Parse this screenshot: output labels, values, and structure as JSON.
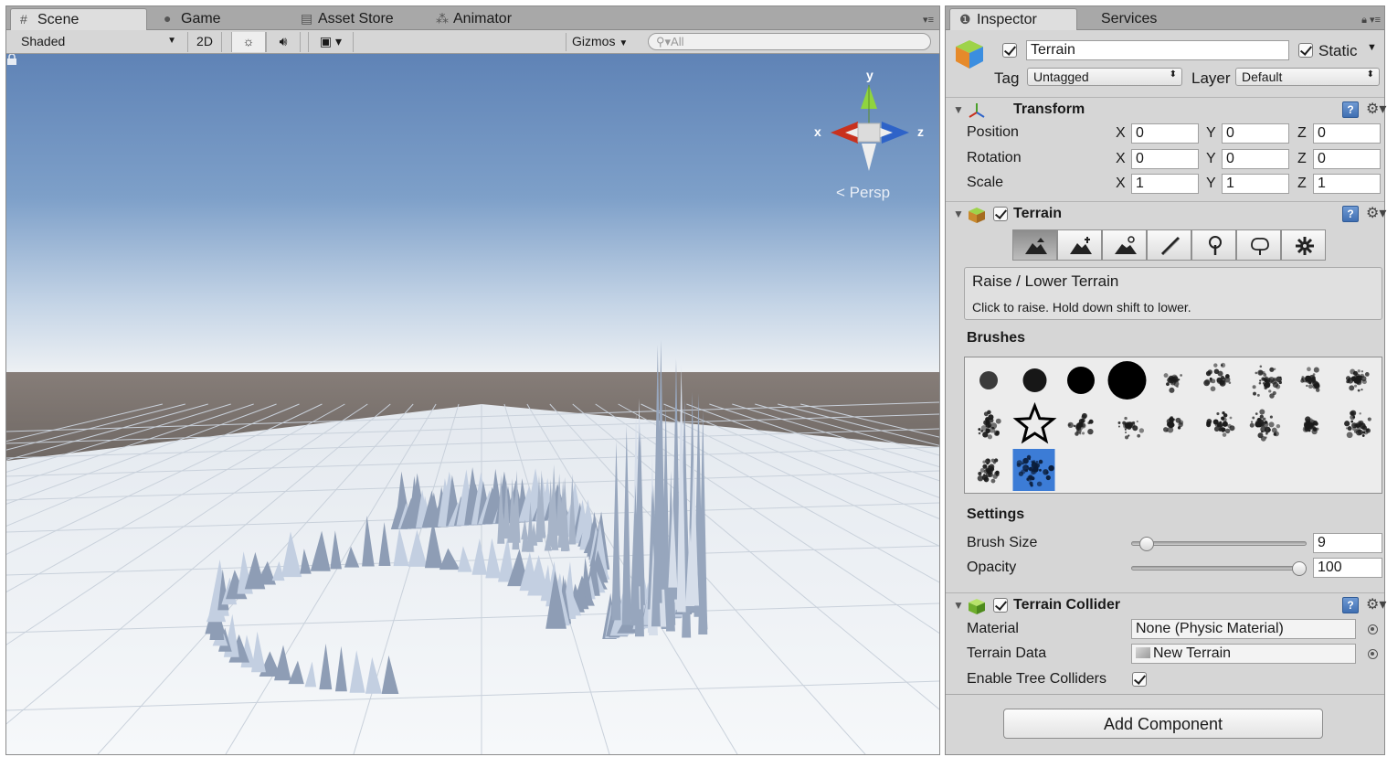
{
  "scene_tabs": [
    {
      "label": "Scene",
      "icon": "hash-grid-icon"
    },
    {
      "label": "Game",
      "icon": "pacman-icon"
    },
    {
      "label": "Asset Store",
      "icon": "store-bag-icon"
    },
    {
      "label": "Animator",
      "icon": "animator-nodes-icon"
    }
  ],
  "scene_toolbar": {
    "draw_mode": "Shaded",
    "mode_2d": "2D",
    "gizmos": "Gizmos",
    "search_placeholder": "All"
  },
  "viewport": {
    "projection": "Persp",
    "gizmo_axes": {
      "y": "y",
      "x": "x",
      "z": "z"
    }
  },
  "inspector_tabs": [
    {
      "label": "Inspector",
      "icon": "info-icon"
    },
    {
      "label": "Services"
    }
  ],
  "object": {
    "name": "Terrain",
    "active": true,
    "static_label": "Static",
    "static": true,
    "tag_label": "Tag",
    "tag": "Untagged",
    "layer_label": "Layer",
    "layer": "Default"
  },
  "transform": {
    "title": "Transform",
    "rows": [
      {
        "label": "Position",
        "x": "0",
        "y": "0",
        "z": "0"
      },
      {
        "label": "Rotation",
        "x": "0",
        "y": "0",
        "z": "0"
      },
      {
        "label": "Scale",
        "x": "1",
        "y": "1",
        "z": "1"
      }
    ],
    "axis_labels": {
      "x": "X",
      "y": "Y",
      "z": "Z"
    }
  },
  "terrain": {
    "title": "Terrain",
    "enabled": true,
    "tools": [
      "raise-lower-icon",
      "paint-height-icon",
      "smooth-height-icon",
      "paint-texture-icon",
      "place-trees-icon",
      "paint-details-icon",
      "terrain-settings-icon"
    ],
    "selected_tool": 0,
    "tool_title": "Raise / Lower Terrain",
    "tool_hint": "Click to raise. Hold down shift to lower.",
    "brushes_label": "Brushes",
    "brush_count": 20,
    "selected_brush": 19,
    "settings_label": "Settings",
    "brush_size_label": "Brush Size",
    "brush_size": "9",
    "brush_size_fraction": 0.05,
    "opacity_label": "Opacity",
    "opacity": "100",
    "opacity_fraction": 1.0
  },
  "terrain_collider": {
    "title": "Terrain Collider",
    "enabled": true,
    "material_label": "Material",
    "material": "None (Physic Material)",
    "terrain_data_label": "Terrain Data",
    "terrain_data": "New Terrain",
    "tree_colliders_label": "Enable Tree Colliders",
    "tree_colliders": true
  },
  "add_component": "Add Component",
  "colors": {
    "sky_top": "#5f85b8",
    "sky_horizon": "#eef1f4",
    "ground_far": "#7d7672",
    "terrain_spikes": "#c3cfe1",
    "selection_blue": "#3c7cd6"
  }
}
